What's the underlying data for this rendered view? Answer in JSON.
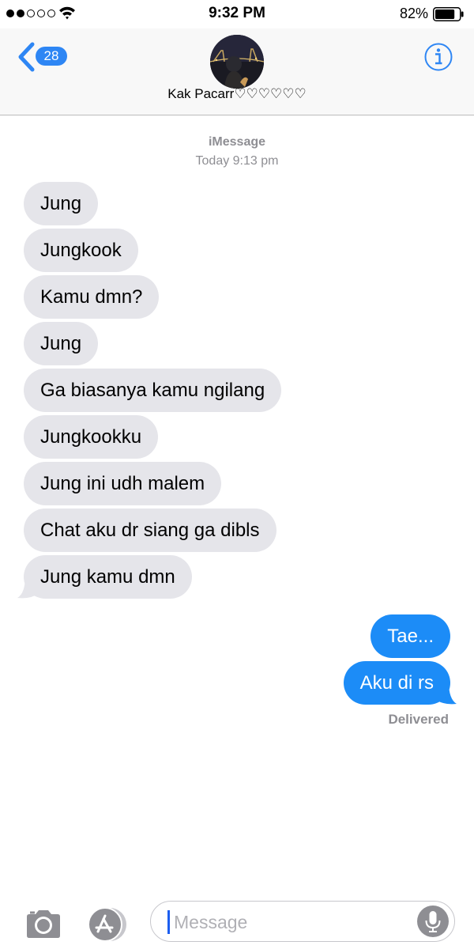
{
  "status_bar": {
    "time": "9:32 PM",
    "battery_percent": "82%",
    "signal_bars_filled": 2,
    "signal_bars_total": 5,
    "battery_level": 0.82
  },
  "header": {
    "back_badge": "28",
    "contact_name": "Kak Pacarr♡♡♡♡♡♡",
    "icons": [
      "back-chevron-icon",
      "contact-avatar",
      "info-icon"
    ]
  },
  "conversation": {
    "service": "iMessage",
    "timestamp": "Today 9:13 pm",
    "incoming": [
      "Jung",
      "Jungkook",
      "Kamu dmn?",
      "Jung",
      "Ga biasanya kamu ngilang",
      "Jungkookku",
      "Jung ini udh malem",
      "Chat aku dr siang ga dibls",
      "Jung kamu dmn"
    ],
    "outgoing": [
      "Tae...",
      "Aku di rs"
    ],
    "status": "Delivered"
  },
  "input_bar": {
    "placeholder": "Message",
    "icons": [
      "camera-icon",
      "app-store-icon",
      "microphone-icon"
    ]
  },
  "colors": {
    "incoming_bubble": "#e5e5ea",
    "outgoing_bubble": "#1c8cf7",
    "accent": "#2e86f4",
    "meta_text": "#8e8e93"
  }
}
